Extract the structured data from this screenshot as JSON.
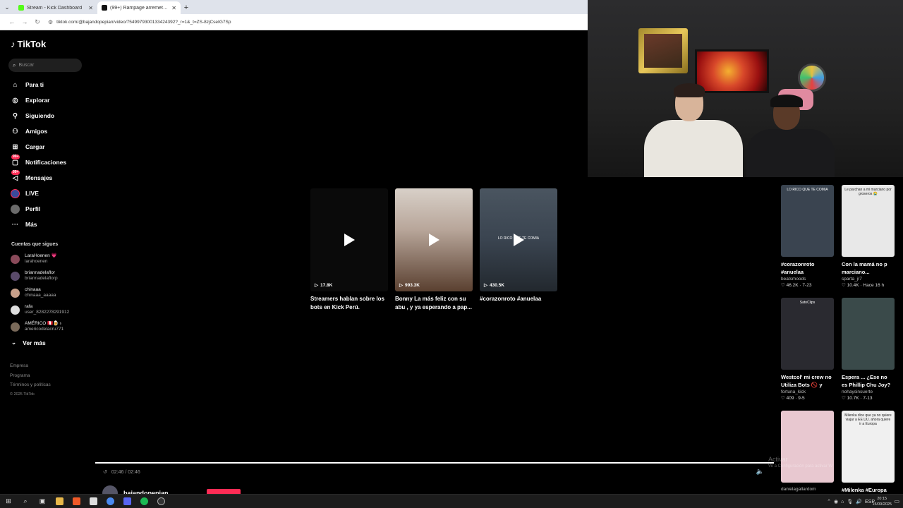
{
  "browser": {
    "tabs": [
      {
        "title": "Stream - Kick Dashboard",
        "active": false,
        "favicon_color": "#53fc18"
      },
      {
        "title": "(99+) Rampage arremete contra",
        "active": true,
        "favicon_color": "#111111"
      }
    ],
    "url": "tiktok.com/@bajandopepian/video/7549979300133424392?_r=1&_t=ZS-8zjCseIG7Sp"
  },
  "sidebar": {
    "logo": "TikTok",
    "search_placeholder": "Buscar",
    "nav": [
      {
        "label": "Para ti",
        "icon": "home-icon",
        "glyph": "⌂",
        "badge": ""
      },
      {
        "label": "Explorar",
        "icon": "compass-icon",
        "glyph": "◎",
        "badge": ""
      },
      {
        "label": "Siguiendo",
        "icon": "following-icon",
        "glyph": "⚲",
        "badge": ""
      },
      {
        "label": "Amigos",
        "icon": "friends-icon",
        "glyph": "⚇",
        "badge": ""
      },
      {
        "label": "Cargar",
        "icon": "upload-icon",
        "glyph": "⊞",
        "badge": ""
      },
      {
        "label": "Notificaciones",
        "icon": "inbox-icon",
        "glyph": "▢",
        "badge": "99+"
      },
      {
        "label": "Mensajes",
        "icon": "messages-icon",
        "glyph": "◁",
        "badge": "99+"
      },
      {
        "label": "LIVE",
        "icon": "live-avatar",
        "glyph": "",
        "badge": ""
      },
      {
        "label": "Perfil",
        "icon": "profile-avatar",
        "glyph": "",
        "badge": ""
      },
      {
        "label": "Más",
        "icon": "more-icon",
        "glyph": "···",
        "badge": ""
      }
    ],
    "following_title": "Cuentas que sigues",
    "following": [
      {
        "name": "LaraHoenen 💗",
        "username": "larahoenen",
        "color": "#8a4a5a"
      },
      {
        "name": "briannadelaflor",
        "username": "briannadelaflorp",
        "color": "#5a4a6a"
      },
      {
        "name": "chinaaa",
        "username": "chinaaa_aaaaa",
        "color": "#c8a08a"
      },
      {
        "name": "rafa",
        "username": "user_8282278291912",
        "color": "#dddddd"
      },
      {
        "name": "AMÉRICO 🇵🇪🍺♁",
        "username": "americodelacru771",
        "color": "#7a6a5a"
      }
    ],
    "see_more": "Ver más",
    "footer": [
      "Empresa",
      "Programa",
      "Términos y políticas"
    ],
    "copyright": "© 2025 TikTok"
  },
  "main": {
    "cards": [
      {
        "views": "17.8K",
        "caption": "Streamers hablan sobre los bots en Kick Perú. #kickper...",
        "bg": "#0a0a0a"
      },
      {
        "views": "993.3K",
        "caption": "Bonny La más feliz con su abu , y ya esperando a pap...",
        "bg": "#b8a69a"
      },
      {
        "views": "430.5K",
        "caption": "#corazonroto #anuelaa",
        "bg": "#3a4450",
        "overlay": "LO RICO QUE TE COMIA"
      }
    ],
    "time": "02:46 / 02:46",
    "progress": 1.0,
    "author": "bajandopepian"
  },
  "recommendations": [
    {
      "title": "#corazonroto #anuelaa",
      "author": "beatsmoods",
      "likes": "46.2K",
      "date": "7-23",
      "bg": "#3a4450",
      "overlay": "LO RICO QUE TE COMIA"
    },
    {
      "title": "Con la mamá no p marciano...",
      "author": "sparta_jr7",
      "likes": "10.4K",
      "date": "Hace 16 h",
      "bg": "#e8e8e8",
      "overlay": "Le parchan a mi marciano por groseros 😭"
    },
    {
      "title": "Westcol' mi crew no Utiliza Bots 🚫 y Mr...",
      "author": "fortuna_kick",
      "likes": "409",
      "date": "9-5",
      "bg": "#2a2a30",
      "overlay": "SatoClips"
    },
    {
      "title": "Espera ... ¿Ese no es Phillip Chu Joy? 😳 ...",
      "author": "nohaysinsuerte",
      "likes": "10.7K",
      "date": "7-13",
      "bg": "#3a4a4a",
      "overlay": ""
    },
    {
      "title": "",
      "author": "danielagallardom",
      "likes": "",
      "date": "",
      "bg": "#e8c8d0",
      "overlay": ""
    },
    {
      "title": "#Milenka #Europa",
      "author": "",
      "likes": "",
      "date": "",
      "bg": "#f0f0f0",
      "overlay": "Milenka dice que ya no quiere viajar a EE.UU. ahora quiere ir a Europa"
    }
  ],
  "watermark": {
    "line1": "Activar",
    "line2": "Ve a Configuración para activar W"
  },
  "taskbar": {
    "lang": "ESP",
    "time": "20:15",
    "date": "15/09/2025"
  }
}
